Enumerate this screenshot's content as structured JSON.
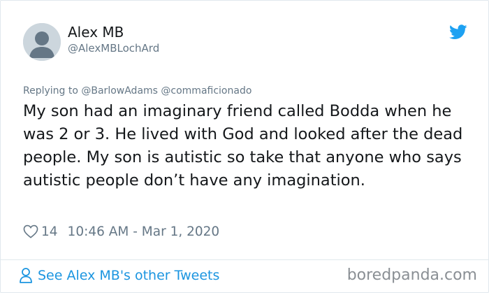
{
  "author": {
    "name": "Alex MB",
    "handle": "@AlexMBLochArd",
    "avatar_icon": "default-avatar-icon"
  },
  "brand": {
    "icon": "twitter-bird-icon",
    "color": "#1da1f2"
  },
  "reply": {
    "text": "Replying to @BarlowAdams @commaficionado"
  },
  "tweet": {
    "text": "My son had an imaginary friend called Bodda when he was 2 or 3. He lived with God and looked after the dead people. My son is autistic so take that anyone who says autistic people don’t have any imagination.",
    "likes": "14",
    "timestamp": "10:46 AM - Mar 1, 2020"
  },
  "footer": {
    "see_more_label": "See Alex MB's other Tweets",
    "link_color": "#1b95e0"
  },
  "watermark": {
    "text": "boredpanda.com"
  }
}
